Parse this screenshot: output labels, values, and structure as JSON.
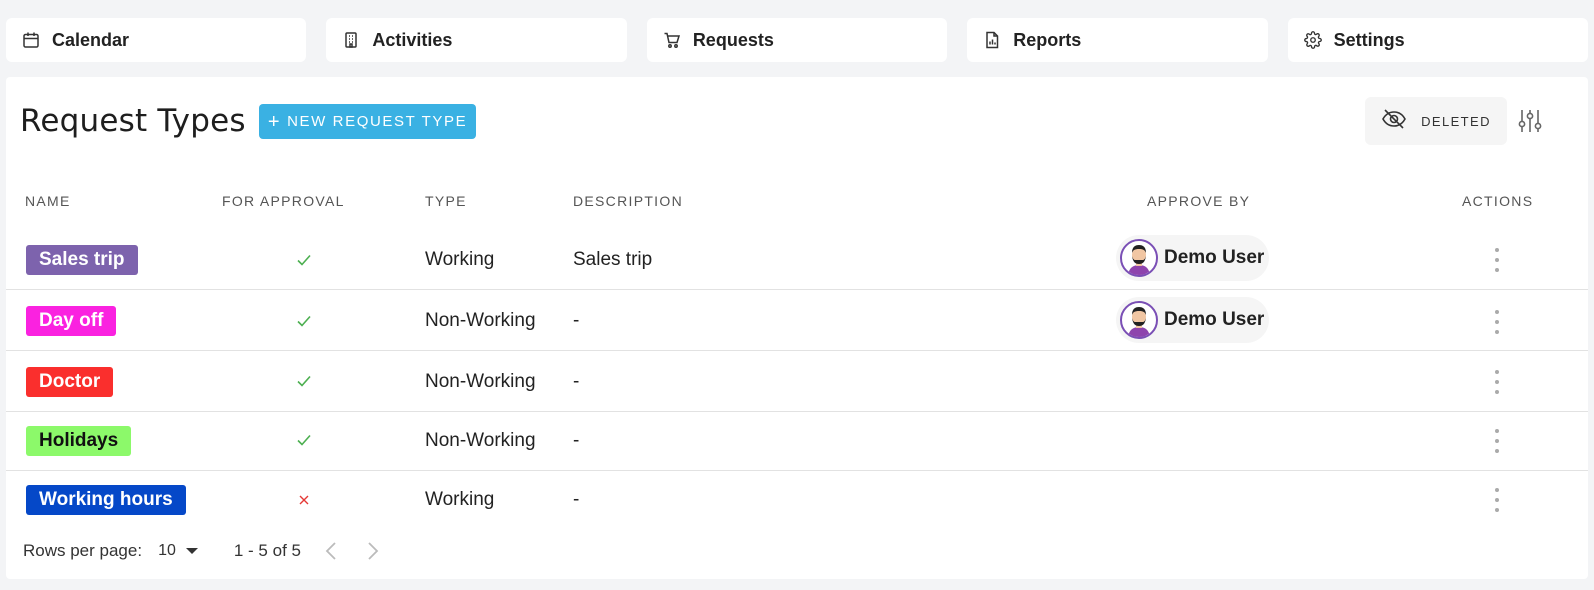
{
  "nav": [
    {
      "label": "Calendar",
      "icon": "calendar-icon"
    },
    {
      "label": "Activities",
      "icon": "building-icon"
    },
    {
      "label": "Requests",
      "icon": "cart-icon"
    },
    {
      "label": "Reports",
      "icon": "report-icon"
    },
    {
      "label": "Settings",
      "icon": "gear-icon"
    }
  ],
  "page": {
    "title": "Request Types",
    "new_button": "NEW REQUEST TYPE",
    "deleted_label": "DELETED"
  },
  "table": {
    "headers": {
      "name": "NAME",
      "for_approval": "FOR APPROVAL",
      "type": "TYPE",
      "description": "DESCRIPTION",
      "approve_by": "APPROVE BY",
      "actions": "ACTIONS"
    },
    "rows": [
      {
        "name": "Sales trip",
        "color": "#7d63ad",
        "text_color": "#ffffff",
        "for_approval": true,
        "type": "Working",
        "description": "Sales trip",
        "approve_by": "Demo User"
      },
      {
        "name": "Day off",
        "color": "#fa22e0",
        "text_color": "#ffffff",
        "for_approval": true,
        "type": "Non-Working",
        "description": "-",
        "approve_by": "Demo User"
      },
      {
        "name": "Doctor",
        "color": "#fa2f2d",
        "text_color": "#ffffff",
        "for_approval": true,
        "type": "Non-Working",
        "description": "-",
        "approve_by": ""
      },
      {
        "name": "Holidays",
        "color": "#8cf96a",
        "text_color": "#111111",
        "for_approval": true,
        "type": "Non-Working",
        "description": "-",
        "approve_by": ""
      },
      {
        "name": "Working hours",
        "color": "#0548c8",
        "text_color": "#ffffff",
        "for_approval": false,
        "type": "Working",
        "description": "-",
        "approve_by": ""
      }
    ]
  },
  "footer": {
    "rows_per_page_label": "Rows per page:",
    "rows_per_page_value": "10",
    "range": "1 - 5 of 5"
  },
  "colors": {
    "accent": "#3ab1e3",
    "check": "#4caf50",
    "cross": "#e53935"
  }
}
